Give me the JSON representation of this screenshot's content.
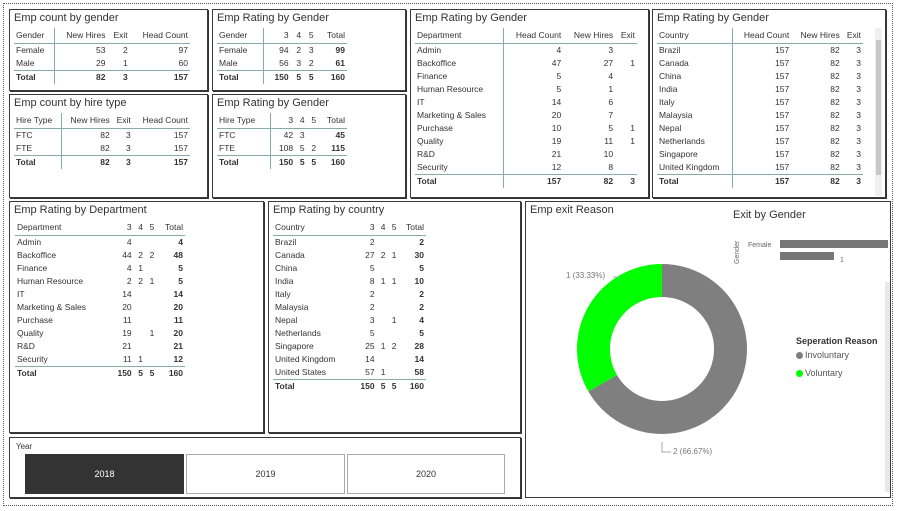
{
  "colors": {
    "involuntary": "#7f7f7f",
    "voluntary": "#00ff00",
    "bar": "#777777",
    "selected_bg": "#333333"
  },
  "count_by_gender": {
    "title": "Emp count by gender",
    "headers": [
      "Gender",
      "New Hires",
      "Exit",
      "Head Count"
    ],
    "rows": [
      [
        "Female",
        "53",
        "2",
        "97"
      ],
      [
        "Male",
        "29",
        "1",
        "60"
      ]
    ],
    "total": [
      "Total",
      "82",
      "3",
      "157"
    ]
  },
  "count_by_hire": {
    "title": "Emp count by hire type",
    "headers": [
      "Hire Type",
      "New Hires",
      "Exit",
      "Head Count"
    ],
    "rows": [
      [
        "FTC",
        "82",
        "3",
        "157"
      ],
      [
        "FTE",
        "82",
        "3",
        "157"
      ]
    ],
    "total": [
      "Total",
      "82",
      "3",
      "157"
    ]
  },
  "rating_gender": {
    "title": "Emp Rating by Gender",
    "headers": [
      "Gender",
      "3",
      "4",
      "5",
      "Total"
    ],
    "rows": [
      [
        "Female",
        "94",
        "2",
        "3",
        "99"
      ],
      [
        "Male",
        "56",
        "3",
        "2",
        "61"
      ]
    ],
    "total": [
      "Total",
      "150",
      "5",
      "5",
      "160"
    ]
  },
  "rating_hire": {
    "title": "Emp Rating by Gender",
    "headers": [
      "Hire Type",
      "3",
      "4",
      "5",
      "Total"
    ],
    "rows": [
      [
        "FTC",
        "42",
        "3",
        "",
        "45"
      ],
      [
        "FTE",
        "108",
        "5",
        "2",
        "115"
      ]
    ],
    "total": [
      "Total",
      "150",
      "5",
      "5",
      "160"
    ]
  },
  "dept_counts": {
    "title": "Emp Rating by Gender",
    "headers": [
      "Department",
      "Head Count",
      "New Hires",
      "Exit"
    ],
    "rows": [
      [
        "Admin",
        "4",
        "3",
        ""
      ],
      [
        "Backoffice",
        "47",
        "27",
        "1"
      ],
      [
        "Finance",
        "5",
        "4",
        ""
      ],
      [
        "Human Resource",
        "5",
        "1",
        ""
      ],
      [
        "IT",
        "14",
        "6",
        ""
      ],
      [
        "Marketing & Sales",
        "20",
        "7",
        ""
      ],
      [
        "Purchase",
        "10",
        "5",
        "1"
      ],
      [
        "Quality",
        "19",
        "11",
        "1"
      ],
      [
        "R&D",
        "21",
        "10",
        ""
      ],
      [
        "Security",
        "12",
        "8",
        ""
      ]
    ],
    "total": [
      "Total",
      "157",
      "82",
      "3"
    ]
  },
  "country_counts": {
    "title": "Emp Rating by Gender",
    "headers": [
      "Country",
      "Head Count",
      "New Hires",
      "Exit"
    ],
    "rows": [
      [
        "Brazil",
        "157",
        "82",
        "3"
      ],
      [
        "Canada",
        "157",
        "82",
        "3"
      ],
      [
        "China",
        "157",
        "82",
        "3"
      ],
      [
        "India",
        "157",
        "82",
        "3"
      ],
      [
        "Italy",
        "157",
        "82",
        "3"
      ],
      [
        "Malaysia",
        "157",
        "82",
        "3"
      ],
      [
        "Nepal",
        "157",
        "82",
        "3"
      ],
      [
        "Netherlands",
        "157",
        "82",
        "3"
      ],
      [
        "Singapore",
        "157",
        "82",
        "3"
      ],
      [
        "United Kingdom",
        "157",
        "82",
        "3"
      ]
    ],
    "total": [
      "Total",
      "157",
      "82",
      "3"
    ]
  },
  "rating_dept": {
    "title": "Emp Rating by Department",
    "headers": [
      "Department",
      "3",
      "4",
      "5",
      "Total"
    ],
    "rows": [
      [
        "Admin",
        "4",
        "",
        "",
        "4"
      ],
      [
        "Backoffice",
        "44",
        "2",
        "2",
        "48"
      ],
      [
        "Finance",
        "4",
        "1",
        "",
        "5"
      ],
      [
        "Human Resource",
        "2",
        "2",
        "1",
        "5"
      ],
      [
        "IT",
        "14",
        "",
        "",
        "14"
      ],
      [
        "Marketing & Sales",
        "20",
        "",
        "",
        "20"
      ],
      [
        "Purchase",
        "11",
        "",
        "",
        "11"
      ],
      [
        "Quality",
        "19",
        "",
        "1",
        "20"
      ],
      [
        "R&D",
        "21",
        "",
        "",
        "21"
      ],
      [
        "Security",
        "11",
        "1",
        "",
        "12"
      ]
    ],
    "total": [
      "Total",
      "150",
      "5",
      "5",
      "160"
    ]
  },
  "rating_country": {
    "title": "Emp Rating by country",
    "headers": [
      "Country",
      "3",
      "4",
      "5",
      "Total"
    ],
    "rows": [
      [
        "Brazil",
        "2",
        "",
        "",
        "2"
      ],
      [
        "Canada",
        "27",
        "2",
        "1",
        "30"
      ],
      [
        "China",
        "5",
        "",
        "",
        "5"
      ],
      [
        "India",
        "8",
        "1",
        "1",
        "10"
      ],
      [
        "Italy",
        "2",
        "",
        "",
        "2"
      ],
      [
        "Malaysia",
        "2",
        "",
        "",
        "2"
      ],
      [
        "Nepal",
        "3",
        "",
        "1",
        "4"
      ],
      [
        "Netherlands",
        "5",
        "",
        "",
        "5"
      ],
      [
        "Singapore",
        "25",
        "1",
        "2",
        "28"
      ],
      [
        "United Kingdom",
        "14",
        "",
        "",
        "14"
      ],
      [
        "United States",
        "57",
        "1",
        "",
        "58"
      ]
    ],
    "total": [
      "Total",
      "150",
      "5",
      "5",
      "160"
    ]
  },
  "exit_reason": {
    "title": "Emp exit Reason",
    "bar_title": "Exit by Gender",
    "bar_axis": "Gender",
    "bar_female_label": "Female",
    "bar_value_label": "1",
    "legend_title": "Seperation Reason",
    "legend": [
      "Involuntary",
      "Voluntary"
    ],
    "chart_data": {
      "type": "pie",
      "categories": [
        "Involuntary",
        "Voluntary"
      ],
      "values": [
        2,
        1
      ],
      "labels": [
        "2 (66.67%)",
        "1 (33.33%)"
      ]
    },
    "bar_data": {
      "type": "bar",
      "categories": [
        "Female",
        ""
      ],
      "values": [
        2,
        1
      ]
    }
  },
  "year_slicer": {
    "label": "Year",
    "options": [
      "2018",
      "2019",
      "2020"
    ],
    "selected": "2018"
  }
}
